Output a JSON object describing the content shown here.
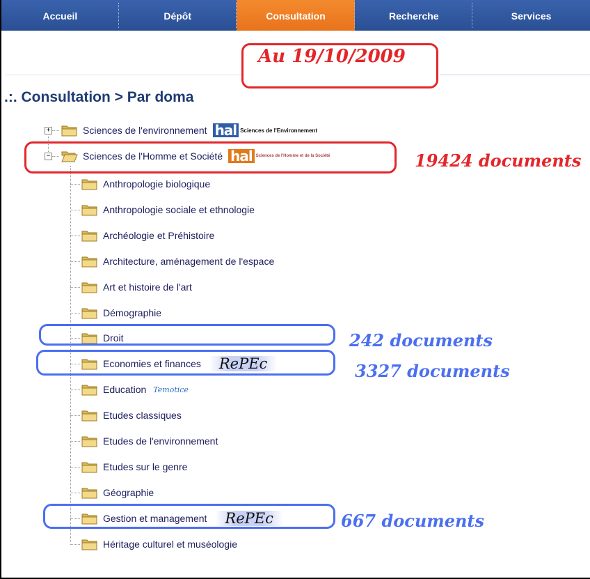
{
  "nav": {
    "items": [
      "Accueil",
      "Dépôt",
      "Consultation",
      "Recherche",
      "Services"
    ],
    "active": "Consultation"
  },
  "page_title": ".:. Consultation > Par doma",
  "annotations": {
    "date": "Au 19/10/2009",
    "shs_count": "19424 documents",
    "droit_count": "242 documents",
    "eco_count": "3327 documents",
    "gestion_count": "667 documents"
  },
  "tree": {
    "top": [
      {
        "label": "Sciences de l'environnement",
        "logo": "hal",
        "logo_text": "Sciences de l'Environnement"
      },
      {
        "label": "Sciences de l'Homme et Société",
        "logo": "hal-orange",
        "logo_text": "Sciences de l'Homme et de la Société"
      }
    ],
    "children": [
      "Anthropologie biologique",
      "Anthropologie sociale et ethnologie",
      "Archéologie et Préhistoire",
      "Architecture, aménagement de l'espace",
      "Art et histoire de l'art",
      "Démographie",
      "Droit",
      "Economies et finances",
      "Education",
      "Etudes classiques",
      "Etudes de l'environnement",
      "Etudes sur le genre",
      "Géographie",
      "Gestion et management",
      "Héritage culturel et muséologie"
    ],
    "repec_label": "RePEc",
    "temotice_label": "Temotice",
    "hal_word": "hal"
  },
  "colors": {
    "nav_bg": "#2d5399",
    "nav_active": "#f07f25",
    "title": "#1f3b73",
    "annotation_red": "#e3262a",
    "annotation_blue": "#4b6ff0"
  }
}
